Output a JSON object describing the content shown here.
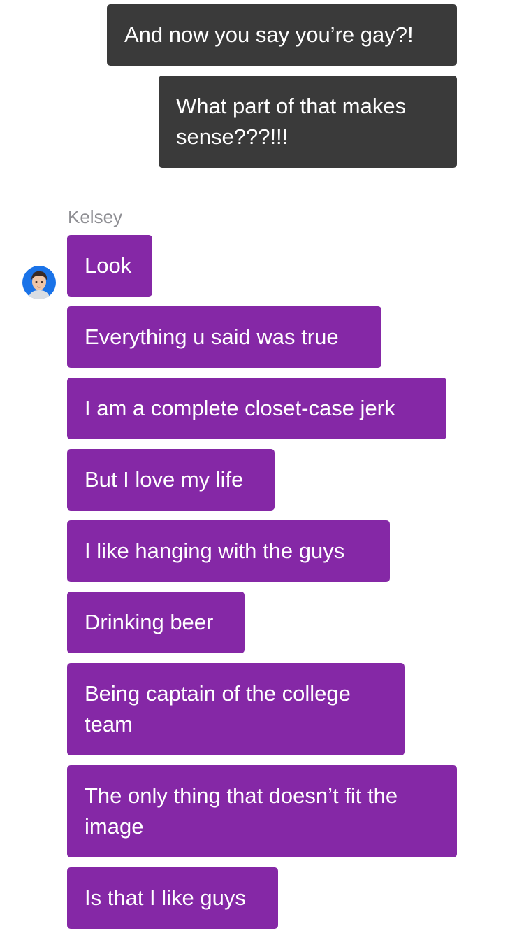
{
  "conversation": {
    "outgoing": [
      "And now you say you’re gay?!",
      "What part of that makes sense???!!!"
    ],
    "sender_name": "Kelsey",
    "avatar_icon": "person-avatar-icon",
    "incoming": [
      "Look",
      "Everything u said was true",
      "I am a complete closet-case jerk",
      "But I love my life",
      "I like hanging with the guys",
      "Drinking beer",
      "Being captain of the college team",
      "The only thing that doesn’t fit the image",
      "Is that I like guys"
    ]
  },
  "colors": {
    "outgoing_bubble": "#3a3a3a",
    "incoming_bubble": "#8528a6",
    "bubble_text": "#ffffff",
    "sender_name": "#8e8e93",
    "avatar_background": "#1a73e8"
  }
}
